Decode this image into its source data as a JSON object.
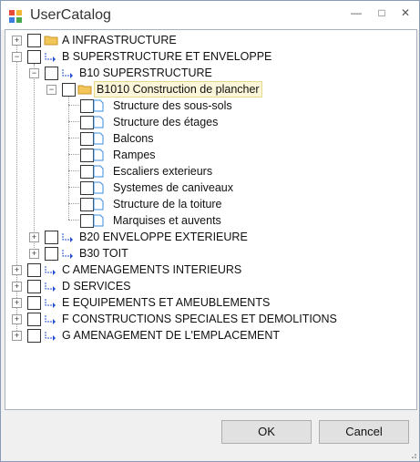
{
  "window": {
    "title": "UserCatalog"
  },
  "tree": {
    "items": [
      {
        "label": "A INFRASTRUCTURE"
      },
      {
        "label": "B SUPERSTRUCTURE ET ENVELOPPE"
      },
      {
        "label": "B10 SUPERSTRUCTURE"
      },
      {
        "label": "B1010 Construction de plancher"
      },
      {
        "label": "Structure des sous-sols"
      },
      {
        "label": "Structure des étages"
      },
      {
        "label": "Balcons"
      },
      {
        "label": "Rampes"
      },
      {
        "label": "Escaliers exterieurs"
      },
      {
        "label": "Systemes de caniveaux"
      },
      {
        "label": "Structure de la toiture"
      },
      {
        "label": "Marquises et auvents"
      },
      {
        "label": "B20 ENVELOPPE EXTERIEURE"
      },
      {
        "label": "B30 TOIT"
      },
      {
        "label": "C AMENAGEMENTS INTERIEURS"
      },
      {
        "label": "D SERVICES"
      },
      {
        "label": "E EQUIPEMENTS ET AMEUBLEMENTS"
      },
      {
        "label": "F CONSTRUCTIONS SPECIALES ET DEMOLITIONS"
      },
      {
        "label": "G AMENAGEMENT DE L'EMPLACEMENT"
      }
    ]
  },
  "buttons": {
    "ok": "OK",
    "cancel": "Cancel"
  },
  "colors": {
    "selected_bg": "#fbf6d9",
    "folder": "#f3c65a",
    "link": "#1f4fd1",
    "doc": "#3a8de0"
  }
}
